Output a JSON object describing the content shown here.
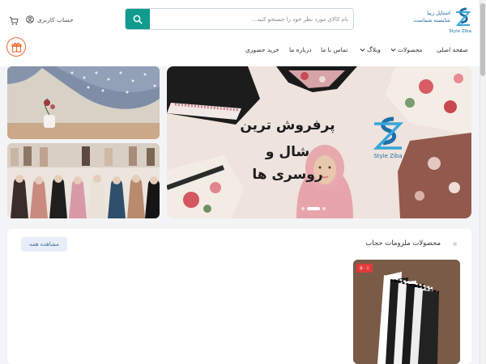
{
  "header": {
    "logo_text_line1": "استایل زیبا",
    "logo_text_line2": "شایسته شماست",
    "logo_sub": "Style Ziba",
    "search_placeholder": "نام کالای مورد نظر خود را جستجو کنید...",
    "account_label": "حساب کاربری",
    "icons": {
      "search": "search-icon",
      "account": "user-circle-icon",
      "cart": "cart-icon",
      "gift": "gift-icon"
    }
  },
  "nav": {
    "items": [
      {
        "label": "صفحه اصلی"
      },
      {
        "label": "محصولات",
        "dropdown": true
      },
      {
        "label": "وبلاگ",
        "dropdown": true
      },
      {
        "label": "تماس با ما"
      },
      {
        "label": "درباره ما"
      },
      {
        "label": "خرید حضوری"
      }
    ]
  },
  "banner": {
    "title_line1": "پرفروش ترین",
    "title_line2": "شال و روسری ها",
    "brand": "Style Ziba",
    "slides": 3,
    "active_slide": 1
  },
  "section": {
    "title": "محصولات ملزومات حجاب",
    "view_all": "مشاهده همه",
    "discount_badge": "۵۰ ٪"
  },
  "colors": {
    "accent": "#0f9b8e",
    "brand_blue": "#1f6fa8",
    "gift_orange": "#e96a2d",
    "discount_red": "#e23a3a"
  }
}
